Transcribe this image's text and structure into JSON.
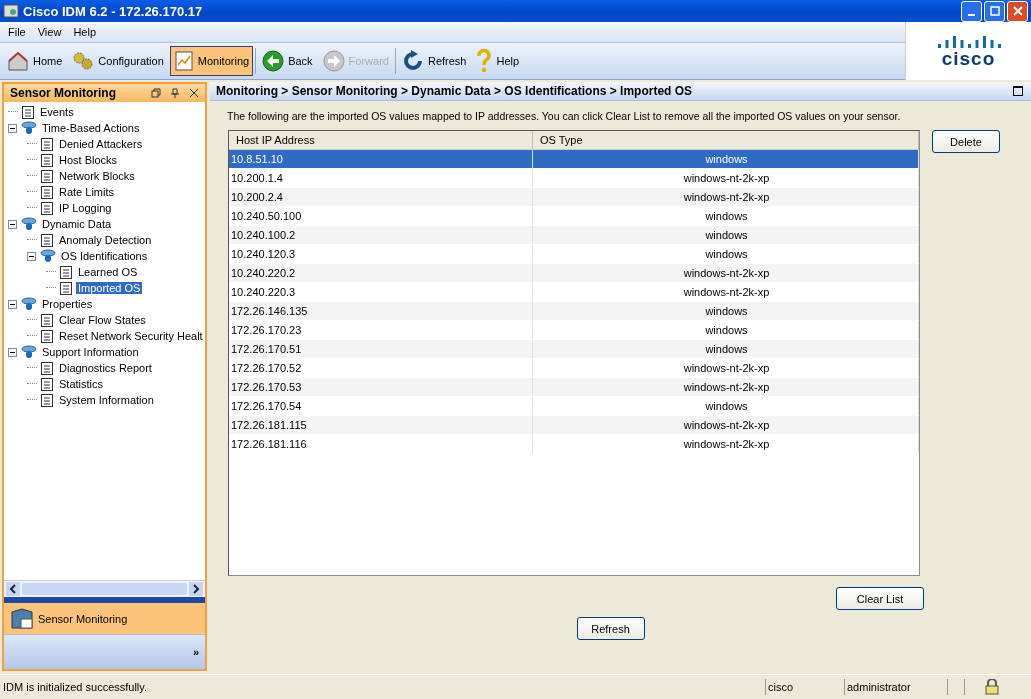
{
  "window": {
    "title": "Cisco IDM 6.2 - 172.26.170.17"
  },
  "menu": [
    "File",
    "View",
    "Help"
  ],
  "logo": "cisco",
  "toolbar": [
    {
      "label": "Home",
      "kind": "home",
      "selected": false,
      "disabled": false
    },
    {
      "label": "Configuration",
      "kind": "gears",
      "selected": false,
      "disabled": false
    },
    {
      "label": "Monitoring",
      "kind": "chart",
      "selected": true,
      "disabled": false
    },
    {
      "label": "Back",
      "kind": "back",
      "selected": false,
      "disabled": false
    },
    {
      "label": "Forward",
      "kind": "forward",
      "selected": false,
      "disabled": true
    },
    {
      "label": "Refresh",
      "kind": "refresh",
      "selected": false,
      "disabled": false
    },
    {
      "label": "Help",
      "kind": "help",
      "selected": false,
      "disabled": false
    }
  ],
  "sidebar": {
    "title": "Sensor Monitoring",
    "tree": [
      {
        "label": "Events",
        "selected": false
      },
      {
        "label": "Time-Based Actions",
        "selected": false,
        "expanded": true,
        "children": [
          {
            "label": "Denied Attackers",
            "selected": false
          },
          {
            "label": "Host Blocks",
            "selected": false
          },
          {
            "label": "Network Blocks",
            "selected": false
          },
          {
            "label": "Rate Limits",
            "selected": false
          },
          {
            "label": "IP Logging",
            "selected": false
          }
        ]
      },
      {
        "label": "Dynamic Data",
        "selected": false,
        "expanded": true,
        "children": [
          {
            "label": "Anomaly Detection",
            "selected": false
          },
          {
            "label": "OS Identifications",
            "selected": false,
            "expanded": true,
            "children": [
              {
                "label": "Learned OS",
                "selected": false
              },
              {
                "label": "Imported OS",
                "selected": true
              }
            ]
          }
        ]
      },
      {
        "label": "Properties",
        "selected": false,
        "expanded": true,
        "children": [
          {
            "label": "Clear Flow States",
            "selected": false
          },
          {
            "label": "Reset Network Security Healt",
            "selected": false
          }
        ]
      },
      {
        "label": "Support Information",
        "selected": false,
        "expanded": true,
        "children": [
          {
            "label": "Diagnostics Report",
            "selected": false
          },
          {
            "label": "Statistics",
            "selected": false
          },
          {
            "label": "System Information",
            "selected": false
          }
        ]
      }
    ],
    "nav_button": "Sensor Monitoring",
    "more": "»"
  },
  "content": {
    "breadcrumb": "Monitoring > Sensor Monitoring > Dynamic Data > OS Identifications > Imported OS",
    "description": "The following are the imported OS values mapped to IP addresses. You can click Clear List to remove all the imported OS values on your sensor.",
    "table": {
      "columns": [
        "Host IP Address",
        "OS Type"
      ],
      "rows": [
        {
          "cells": [
            "10.8.51.10",
            "windows"
          ],
          "selected": true
        },
        {
          "cells": [
            "10.200.1.4",
            "windows-nt-2k-xp"
          ],
          "selected": false
        },
        {
          "cells": [
            "10.200.2.4",
            "windows-nt-2k-xp"
          ],
          "selected": false
        },
        {
          "cells": [
            "10.240.50.100",
            "windows"
          ],
          "selected": false
        },
        {
          "cells": [
            "10.240.100.2",
            "windows"
          ],
          "selected": false
        },
        {
          "cells": [
            "10.240.120.3",
            "windows"
          ],
          "selected": false
        },
        {
          "cells": [
            "10.240.220.2",
            "windows-nt-2k-xp"
          ],
          "selected": false
        },
        {
          "cells": [
            "10.240.220.3",
            "windows-nt-2k-xp"
          ],
          "selected": false
        },
        {
          "cells": [
            "172.26.146.135",
            "windows"
          ],
          "selected": false
        },
        {
          "cells": [
            "172.26.170.23",
            "windows"
          ],
          "selected": false
        },
        {
          "cells": [
            "172.26.170.51",
            "windows"
          ],
          "selected": false
        },
        {
          "cells": [
            "172.26.170.52",
            "windows-nt-2k-xp"
          ],
          "selected": false
        },
        {
          "cells": [
            "172.26.170.53",
            "windows-nt-2k-xp"
          ],
          "selected": false
        },
        {
          "cells": [
            "172.26.170.54",
            "windows"
          ],
          "selected": false
        },
        {
          "cells": [
            "172.26.181.115",
            "windows-nt-2k-xp"
          ],
          "selected": false
        },
        {
          "cells": [
            "172.26.181.116",
            "windows-nt-2k-xp"
          ],
          "selected": false
        }
      ]
    },
    "delete_button": "Delete",
    "clear_button": "Clear List",
    "refresh_button": "Refresh"
  },
  "status_bar": {
    "message": "IDM is initialized successfully.",
    "host": "cisco",
    "user": "administrator"
  }
}
